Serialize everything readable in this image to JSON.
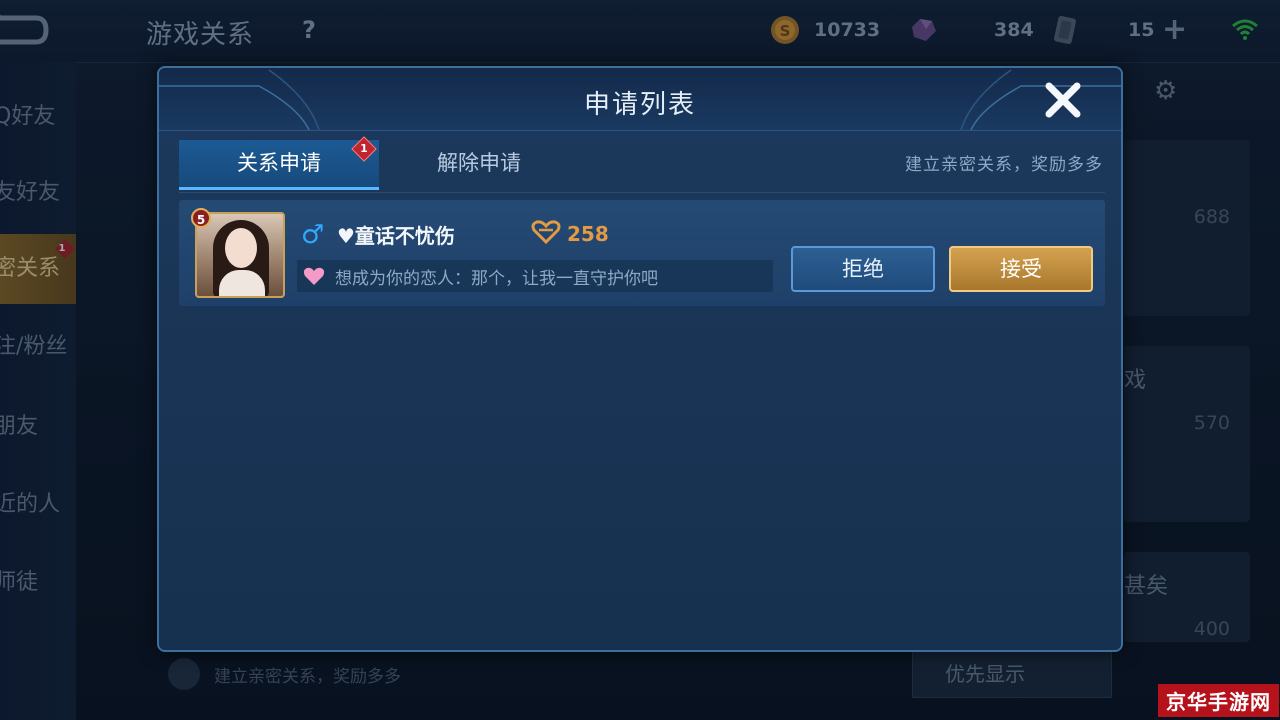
{
  "topbar": {
    "title": "游戏关系",
    "help": "?",
    "gold": "10733",
    "gems": "384",
    "tickets": "15",
    "plus": "+"
  },
  "sidebar": {
    "items": [
      {
        "label": "Q好友"
      },
      {
        "label": "友好友"
      },
      {
        "label": "密关系",
        "badge": "1"
      },
      {
        "label": "注/粉丝"
      },
      {
        "label": "朋友"
      },
      {
        "label": "近的人"
      },
      {
        "label": "师徒"
      }
    ]
  },
  "background": {
    "num1": "688",
    "num2": "570",
    "num3": "400",
    "text1": "戏",
    "text2": "甚矣",
    "bottom_hint": "建立亲密关系，奖励多多",
    "priority_label": "优先显示",
    "watermark": "京华手游网"
  },
  "modal": {
    "title": "申请列表",
    "tabs": [
      {
        "label": "关系申请",
        "badge": "1"
      },
      {
        "label": "解除申请"
      }
    ],
    "tab_hint": "建立亲密关系，奖励多多",
    "requests": [
      {
        "level": "5",
        "name": "♥童话不忧伤",
        "intimacy": "258",
        "message": "想成为你的恋人：那个，让我一直守护你吧",
        "reject_label": "拒绝",
        "accept_label": "接受"
      }
    ]
  },
  "colors": {
    "accent_blue": "#5bb8ff",
    "accept_gold": "#d4a24f",
    "intimacy_orange": "#e39a45",
    "badge_red": "#c0242e"
  },
  "icons": [
    "back-icon",
    "help-icon",
    "gold-coin-icon",
    "gem-icon",
    "ticket-icon",
    "plus-icon",
    "wifi-icon",
    "close-icon",
    "male-icon",
    "intimacy-heart-icon",
    "pink-heart-icon",
    "gear-icon"
  ]
}
